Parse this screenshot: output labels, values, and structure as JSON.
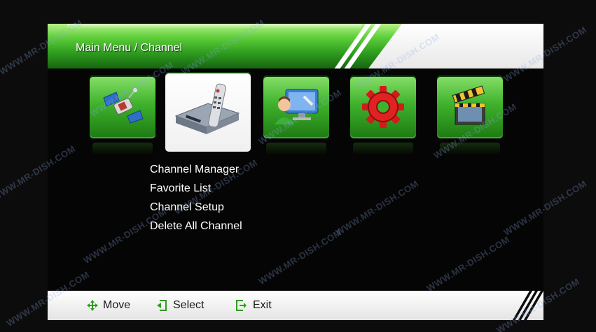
{
  "header": {
    "title": "Main Menu / Channel"
  },
  "icons": [
    {
      "name": "installation-satellite-icon"
    },
    {
      "name": "channel-receiver-icon",
      "selected": true
    },
    {
      "name": "system-user-settings-icon"
    },
    {
      "name": "tools-gear-icon"
    },
    {
      "name": "media-clapperboard-icon"
    }
  ],
  "submenu": {
    "items": [
      {
        "label": "Channel Manager"
      },
      {
        "label": "Favorite List"
      },
      {
        "label": "Channel Setup"
      },
      {
        "label": "Delete All Channel"
      }
    ]
  },
  "footer": {
    "move_label": "Move",
    "select_label": "Select",
    "exit_label": "Exit"
  },
  "watermark": "WWW.MR-DISH.COM",
  "colors": {
    "accent_green": "#3fb22d",
    "header_white": "#ffffff",
    "background": "#050505"
  }
}
